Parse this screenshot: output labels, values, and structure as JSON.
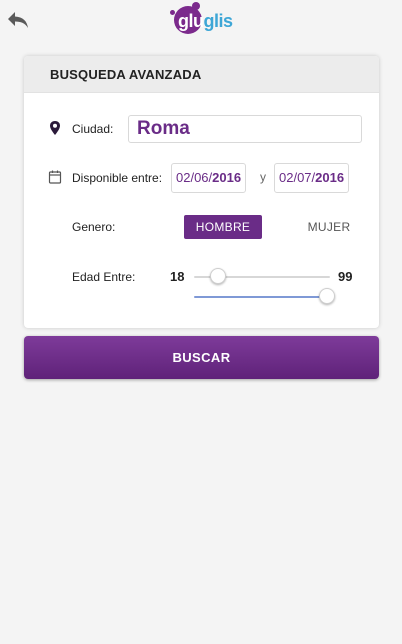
{
  "header": {
    "logo_text_main": "glu",
    "logo_text_tail": "glis"
  },
  "panel": {
    "title": "BUSQUEDA AVANZADA"
  },
  "city": {
    "label": "Ciudad:",
    "value": "Roma"
  },
  "dates": {
    "label": "Disponible entre:",
    "from_day": "02/06/",
    "from_year": "2016",
    "separator": "y",
    "to_day": "02/07/",
    "to_year": "2016"
  },
  "gender": {
    "label": "Genero:",
    "options": [
      "HOMBRE",
      "MUJER"
    ],
    "selected": "HOMBRE"
  },
  "age": {
    "label": "Edad Entre:",
    "min": "18",
    "max": "99"
  },
  "search_button": {
    "label": "BUSCAR"
  },
  "colors": {
    "brand_purple": "#6a2c87",
    "logo_blue": "#3da6d6",
    "slider_blue": "#7f99d6"
  },
  "icons": [
    "back-arrow-icon",
    "map-pin-icon",
    "calendar-icon"
  ]
}
